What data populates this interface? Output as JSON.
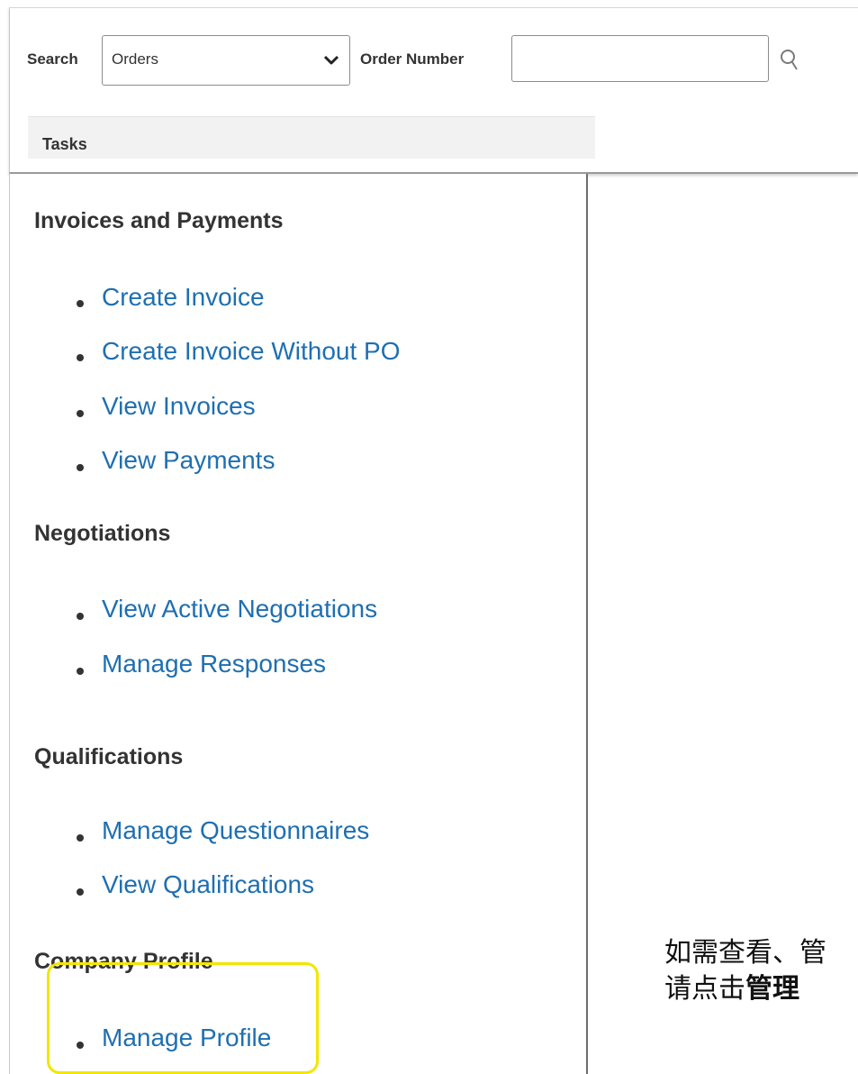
{
  "search": {
    "label": "Search",
    "selected": "Orders",
    "order_number_label": "Order Number",
    "order_number_value": ""
  },
  "tasks": {
    "header": "Tasks",
    "sections": [
      {
        "title": "Invoices and Payments",
        "items": [
          "Create Invoice",
          "Create Invoice Without PO",
          "View Invoices",
          "View Payments"
        ]
      },
      {
        "title": "Negotiations",
        "items": [
          "View Active Negotiations",
          "Manage Responses"
        ]
      },
      {
        "title": "Qualifications",
        "items": [
          "Manage Questionnaires",
          "View Qualifications"
        ]
      },
      {
        "title": "Company Profile",
        "items": [
          "Manage Profile"
        ]
      }
    ]
  },
  "callout": {
    "line1": "如需查看、管",
    "line2_plain": "请点击",
    "line2_bold": "管理"
  },
  "colors": {
    "link": "#1f6fb0",
    "highlight": "#f2e600"
  },
  "icons": [
    "chevron-down-icon",
    "search-icon"
  ]
}
